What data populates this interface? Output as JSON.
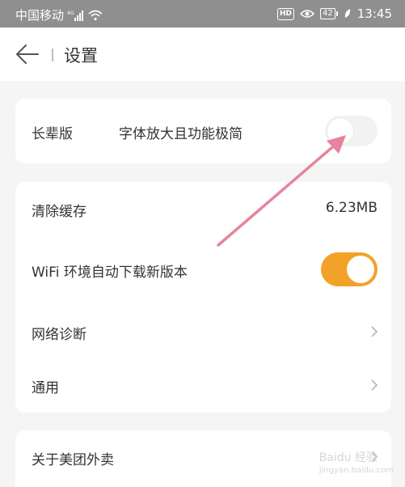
{
  "status_bar": {
    "carrier": "中国移动",
    "network": "4G",
    "hd_label": "HD",
    "battery": "42",
    "time": "13:45"
  },
  "header": {
    "back_icon": "back-arrow-icon",
    "title": "设置"
  },
  "elder_card": {
    "label": "长辈版",
    "description": "字体放大且功能极简",
    "toggle_on": false
  },
  "settings": {
    "clear_cache": {
      "label": "清除缓存",
      "value": "6.23MB"
    },
    "wifi_update": {
      "label": "WiFi 环境自动下载新版本",
      "toggle_on": true
    },
    "network_diag": {
      "label": "网络诊断"
    },
    "general": {
      "label": "通用"
    }
  },
  "about": {
    "label": "关于美团外卖"
  },
  "watermark": {
    "text": "Baidu 经验",
    "sub": "jingyan.baidu.com"
  },
  "colors": {
    "accent": "#f2a228",
    "annotation_arrow": "#e8839c",
    "status_bar": "#8f8f8f",
    "background": "#f5f5f5"
  }
}
